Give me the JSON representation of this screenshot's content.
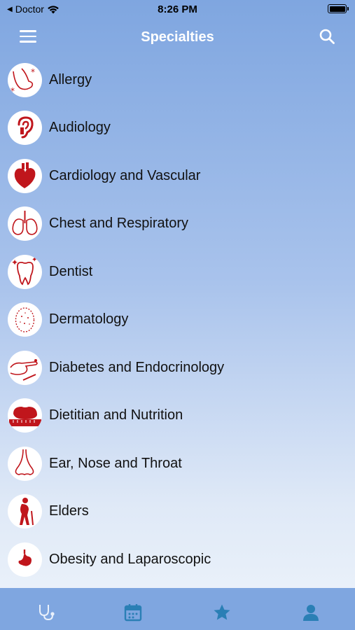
{
  "status": {
    "carrier": "Doctor",
    "time": "8:26 PM"
  },
  "header": {
    "title": "Specialties"
  },
  "colors": {
    "accent": "#c0161c",
    "nav": "#7fa6e0",
    "tab_icon": "#2a7fb5"
  },
  "specialties": [
    {
      "label": "Allergy",
      "icon": "allergy-icon"
    },
    {
      "label": "Audiology",
      "icon": "ear-icon"
    },
    {
      "label": "Cardiology and Vascular",
      "icon": "heart-icon"
    },
    {
      "label": "Chest and Respiratory",
      "icon": "lungs-icon"
    },
    {
      "label": "Dentist",
      "icon": "tooth-icon"
    },
    {
      "label": "Dermatology",
      "icon": "face-skin-icon"
    },
    {
      "label": "Diabetes and Endocrinology",
      "icon": "finger-prick-icon"
    },
    {
      "label": "Dietitian and Nutrition",
      "icon": "apple-measure-icon"
    },
    {
      "label": "Ear, Nose and Throat",
      "icon": "nose-icon"
    },
    {
      "label": "Elders",
      "icon": "elder-icon"
    },
    {
      "label": "Obesity and Laparoscopic",
      "icon": "stomach-icon"
    }
  ],
  "tabs": [
    "stethoscope-icon",
    "calendar-icon",
    "star-icon",
    "person-icon"
  ]
}
